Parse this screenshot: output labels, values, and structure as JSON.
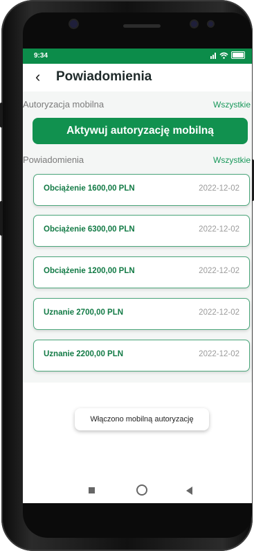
{
  "status_bar": {
    "time": "9:34"
  },
  "header": {
    "back_icon": "chevron-left-icon",
    "title": "Powiadomienia"
  },
  "mobile_auth": {
    "label": "Autoryzacja mobilna",
    "link": "Wszystkie",
    "button": "Aktywuj autoryzację mobilną"
  },
  "notifications": {
    "label": "Powiadomienia",
    "link": "Wszystkie",
    "items": [
      {
        "title": "Obciążenie 1600,00 PLN",
        "date": "2022-12-02"
      },
      {
        "title": "Obciążenie 6300,00 PLN",
        "date": "2022-12-02"
      },
      {
        "title": "Obciążenie 1200,00 PLN",
        "date": "2022-12-02"
      },
      {
        "title": "Uznanie 2700,00 PLN",
        "date": "2022-12-02"
      },
      {
        "title": "Uznanie 2200,00 PLN",
        "date": "2022-12-02"
      }
    ]
  },
  "toast": {
    "text": "Włączono mobilną autoryzację"
  },
  "colors": {
    "brand": "#11914f",
    "link": "#18985a",
    "card_border": "#4aa57a"
  }
}
